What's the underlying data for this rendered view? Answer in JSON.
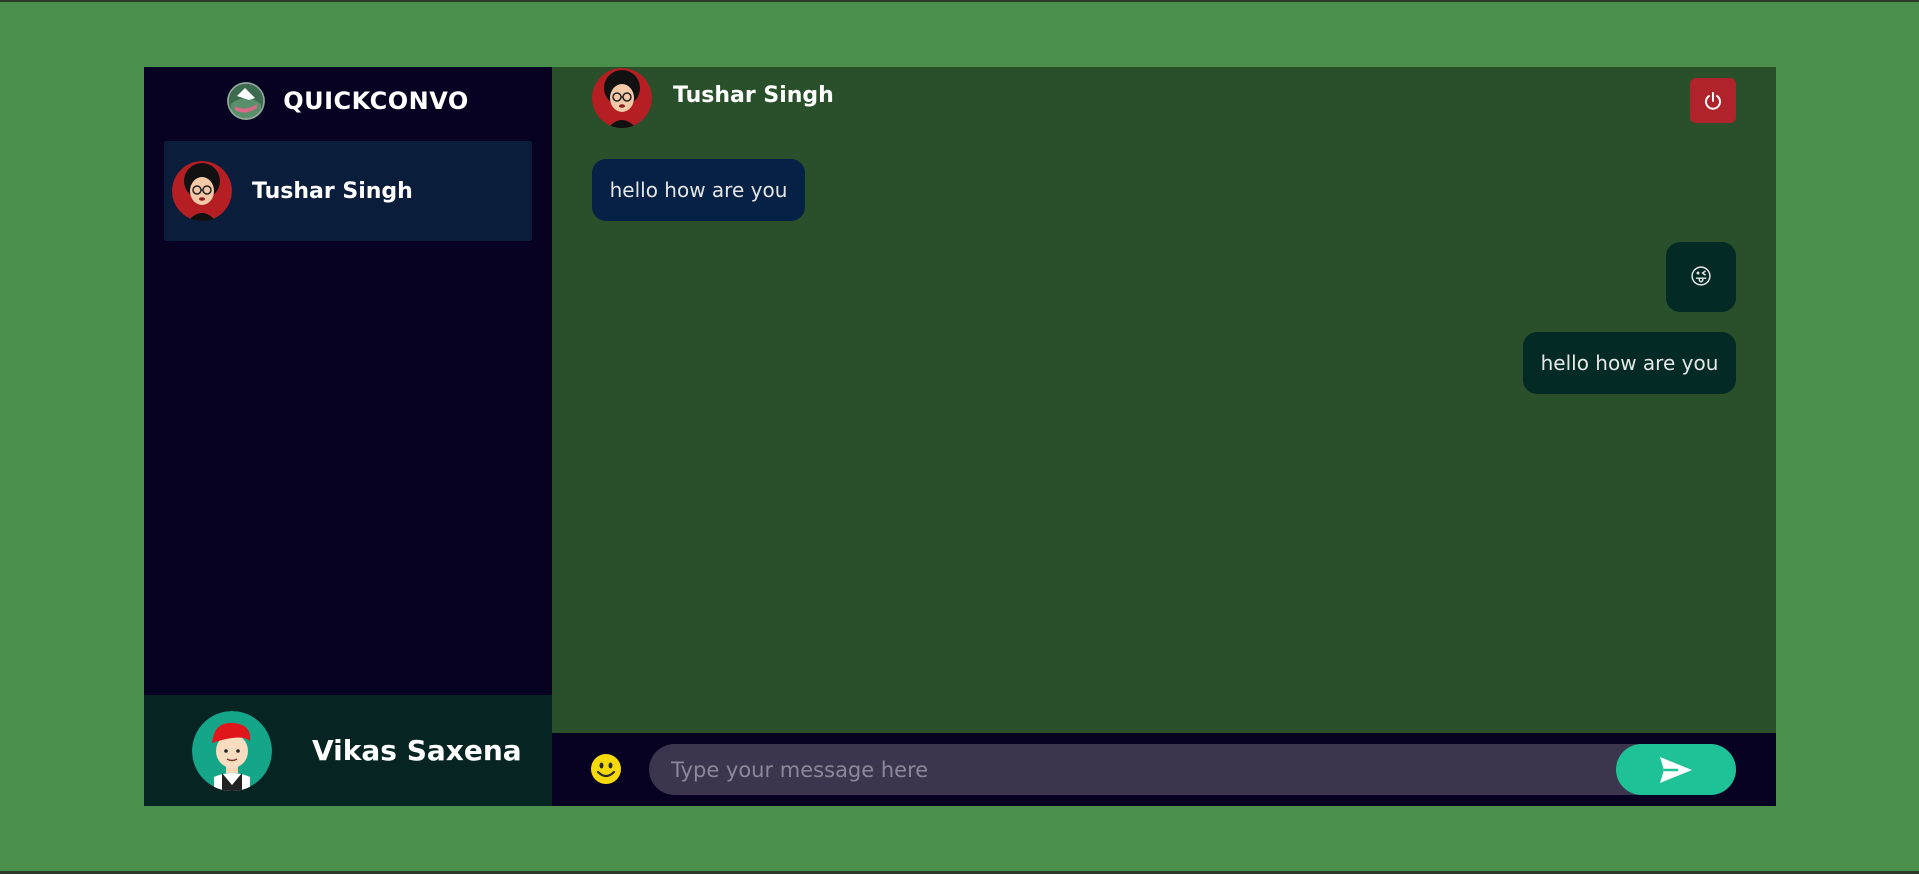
{
  "app": {
    "brand_name": "QUICKCONVO"
  },
  "sidebar": {
    "contacts": [
      {
        "name": "Tushar Singh"
      }
    ],
    "current_user": {
      "name": "Vikas Saxena"
    }
  },
  "chat": {
    "header_name": "Tushar Singh",
    "messages": [
      {
        "direction": "incoming",
        "text": "hello how are you"
      },
      {
        "direction": "outgoing",
        "text": "",
        "emoji": "😜"
      },
      {
        "direction": "outgoing",
        "text": "hello how are you"
      }
    ]
  },
  "composer": {
    "placeholder": "Type your message here",
    "value": ""
  },
  "icons": {
    "power": "power-icon",
    "emoji": "smiley-icon",
    "send": "send-icon"
  },
  "colors": {
    "page_bg": "#4a8f4c",
    "sidebar_bg": "#070222",
    "chat_bg": "#2a502b",
    "incoming_bubble": "#062146",
    "outgoing_bubble": "#042a25",
    "power_button": "#b0232a",
    "send_button": "#1fc196"
  }
}
